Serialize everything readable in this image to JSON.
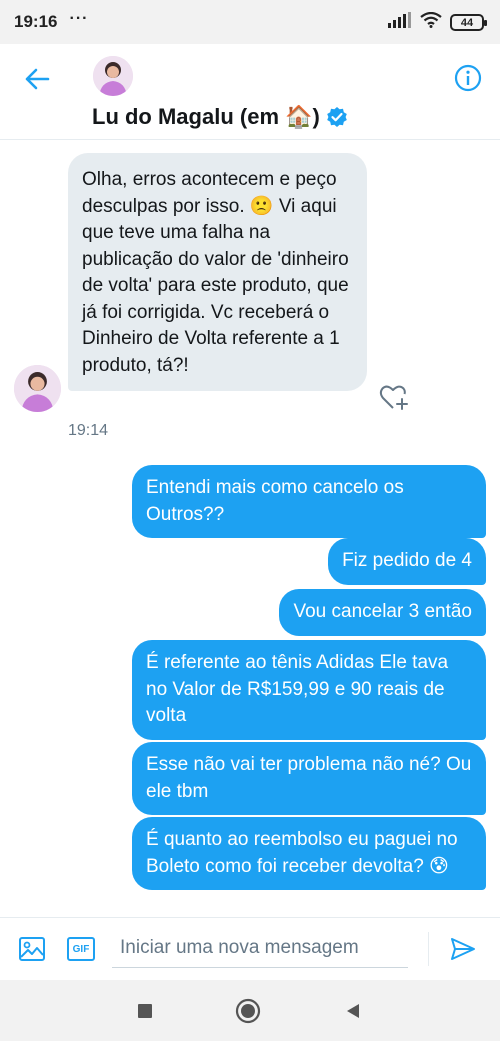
{
  "status_bar": {
    "time": "19:16",
    "dots": "···",
    "battery": "44"
  },
  "header": {
    "name": "Lu do Magalu (em 🏠)",
    "accent_color": "#1da1f2"
  },
  "messages": {
    "received": {
      "text": "Olha, erros acontecem e peço desculpas por isso. 🙁 Vi aqui que teve uma falha na publicação do valor de 'dinheiro de volta' para este produto, que já foi corrigida. Vc receberá o Dinheiro de Volta referente a 1 produto, tá?!",
      "time": "19:14"
    },
    "sent": [
      {
        "text": "Entendi mais como cancelo os Outros??"
      },
      {
        "text": "Fiz pedido de 4"
      },
      {
        "text": "Vou cancelar 3 então"
      },
      {
        "text": "É referente ao tênis Adidas Ele tava no Valor de R$159,99 e 90 reais de volta"
      },
      {
        "text": "Esse não vai ter problema não né? Ou ele tbm"
      },
      {
        "text": "É quanto ao reembolso eu paguei no Boleto como foi receber devolta? 😰"
      }
    ]
  },
  "composer": {
    "placeholder": "Iniciar uma nova mensagem",
    "gif_label": "GIF"
  },
  "colors": {
    "sent_bubble": "#1da1f2",
    "received_bubble": "#e6ecf0"
  }
}
